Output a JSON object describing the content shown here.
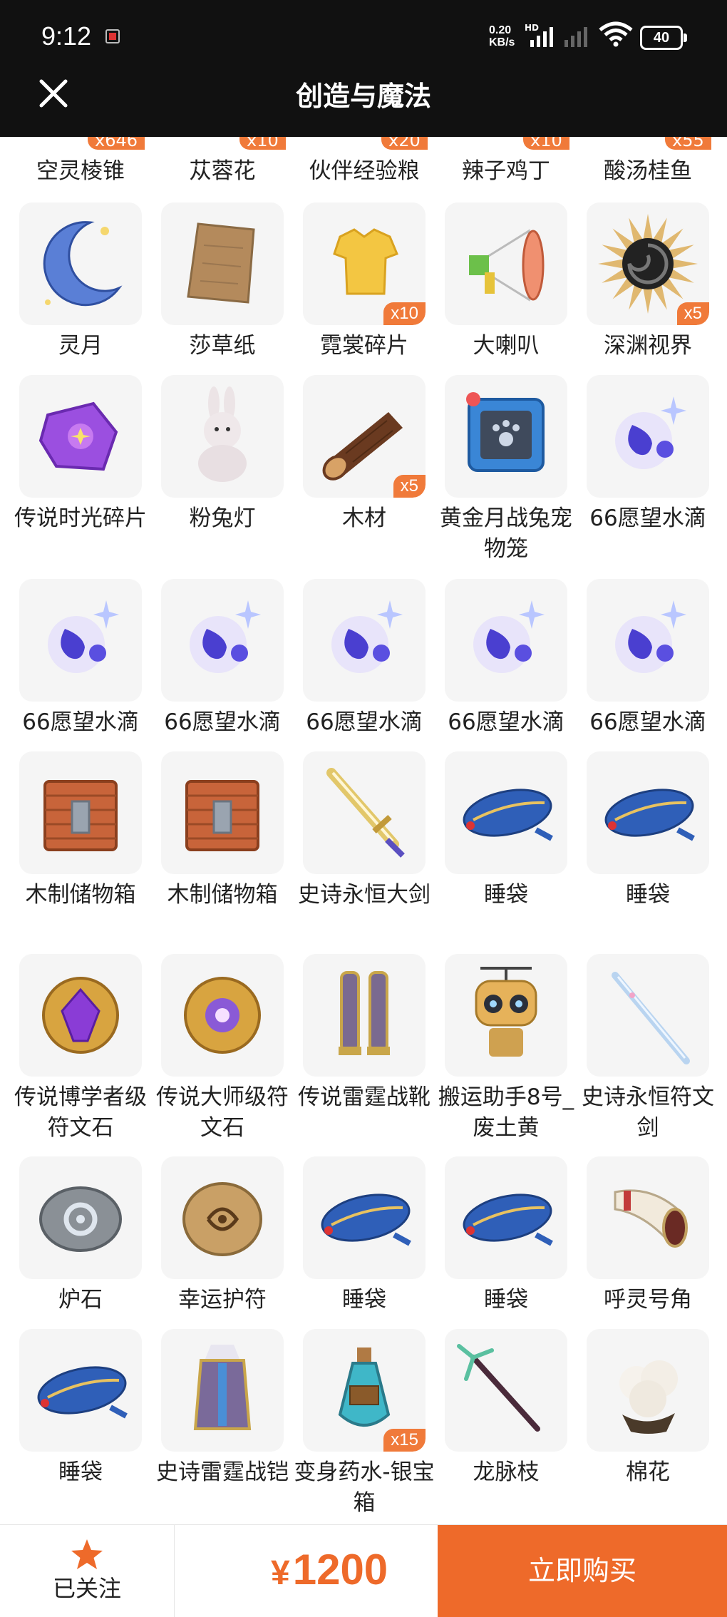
{
  "status": {
    "time": "9:12",
    "net_speed": "0.20",
    "net_unit": "KB/s",
    "network": "HD",
    "battery": "40"
  },
  "header": {
    "title": "创造与魔法"
  },
  "partial_row": [
    {
      "name": "空灵棱锥",
      "count": "x646"
    },
    {
      "name": "苁蓉花",
      "count": "x10"
    },
    {
      "name": "伙伴经验粮",
      "count": "x20"
    },
    {
      "name": "辣子鸡丁",
      "count": "x10"
    },
    {
      "name": "酸汤桂鱼",
      "count": "x55"
    }
  ],
  "items": [
    {
      "name": "灵月",
      "count": "",
      "icon": "crescent-moon-icon"
    },
    {
      "name": "莎草纸",
      "count": "",
      "icon": "papyrus-icon"
    },
    {
      "name": "霓裳碎片",
      "count": "x10",
      "icon": "shirt-fragment-icon"
    },
    {
      "name": "大喇叭",
      "count": "",
      "icon": "megaphone-icon"
    },
    {
      "name": "深渊视界",
      "count": "x5",
      "icon": "abyss-eye-icon"
    },
    {
      "name": "传说时光碎片",
      "count": "",
      "icon": "time-shard-icon"
    },
    {
      "name": "粉兔灯",
      "count": "",
      "icon": "bunny-lamp-icon"
    },
    {
      "name": "木材",
      "count": "x5",
      "icon": "wood-log-icon"
    },
    {
      "name": "黄金月战兔宠物笼",
      "count": "",
      "icon": "pet-cage-icon"
    },
    {
      "name": "66愿望水滴",
      "count": "",
      "icon": "wish-drop-icon"
    },
    {
      "name": "66愿望水滴",
      "count": "",
      "icon": "wish-drop-icon"
    },
    {
      "name": "66愿望水滴",
      "count": "",
      "icon": "wish-drop-icon"
    },
    {
      "name": "66愿望水滴",
      "count": "",
      "icon": "wish-drop-icon"
    },
    {
      "name": "66愿望水滴",
      "count": "",
      "icon": "wish-drop-icon"
    },
    {
      "name": "66愿望水滴",
      "count": "",
      "icon": "wish-drop-icon"
    },
    {
      "name": "木制储物箱",
      "count": "",
      "icon": "wooden-chest-icon"
    },
    {
      "name": "木制储物箱",
      "count": "",
      "icon": "wooden-chest-icon"
    },
    {
      "name": "史诗永恒大剑",
      "count": "",
      "icon": "greatsword-icon"
    },
    {
      "name": "睡袋",
      "count": "",
      "icon": "sleeping-bag-icon"
    },
    {
      "name": "睡袋",
      "count": "",
      "icon": "sleeping-bag-icon"
    },
    {
      "name": "传说博学者级符文石",
      "count": "",
      "icon": "rune-stone-purple-icon"
    },
    {
      "name": "传说大师级符文石",
      "count": "",
      "icon": "rune-stone-gold-icon"
    },
    {
      "name": "传说雷霆战靴",
      "count": "",
      "icon": "thunder-boots-icon"
    },
    {
      "name": "搬运助手8号_废土黄",
      "count": "",
      "icon": "robot-helper-icon"
    },
    {
      "name": "史诗永恒符文剑",
      "count": "",
      "icon": "rune-sword-icon"
    },
    {
      "name": "炉石",
      "count": "",
      "icon": "hearthstone-icon"
    },
    {
      "name": "幸运护符",
      "count": "",
      "icon": "lucky-charm-icon"
    },
    {
      "name": "睡袋",
      "count": "",
      "icon": "sleeping-bag-icon"
    },
    {
      "name": "睡袋",
      "count": "",
      "icon": "sleeping-bag-icon"
    },
    {
      "name": "呼灵号角",
      "count": "",
      "icon": "spirit-horn-icon"
    },
    {
      "name": "睡袋",
      "count": "",
      "icon": "sleeping-bag-icon"
    },
    {
      "name": "史诗雷霆战铠",
      "count": "",
      "icon": "thunder-armor-icon"
    },
    {
      "name": "变身药水-银宝箱",
      "count": "x15",
      "icon": "potion-icon"
    },
    {
      "name": "龙脉枝",
      "count": "",
      "icon": "dragon-branch-icon"
    },
    {
      "name": "棉花",
      "count": "",
      "icon": "cotton-icon"
    }
  ],
  "footer": {
    "follow_label": "已关注",
    "currency": "¥",
    "price": "1200",
    "buy_label": "立即购买"
  },
  "colors": {
    "accent": "#ee6a2a",
    "badge": "#f07a3a",
    "header_bg": "#111111"
  }
}
